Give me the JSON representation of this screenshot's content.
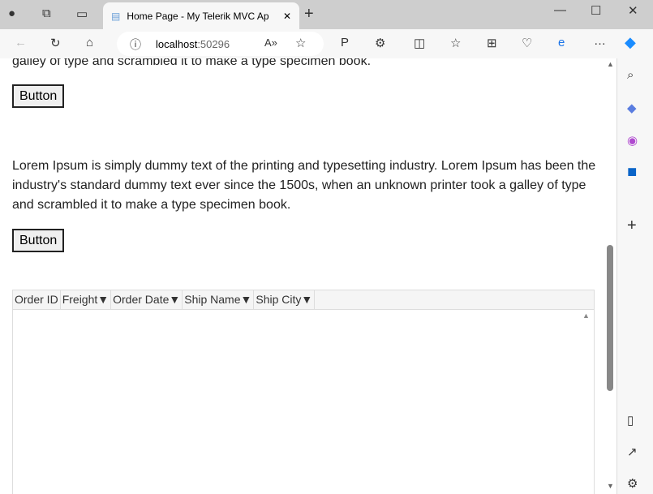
{
  "browser": {
    "tab_title": "Home Page - My Telerik MVC Ap",
    "url_host": "localhost",
    "url_port": ":50296"
  },
  "page": {
    "partial_text": "galley of type and scrambled it to make a type specimen book.",
    "button1": "Button",
    "paragraph": "Lorem Ipsum is simply dummy text of the printing and typesetting industry. Lorem Ipsum has been the industry's standard dummy text ever since the 1500s, when an unknown printer took a galley of type and scrambled it to make a type specimen book.",
    "button2": "Button",
    "grid": {
      "columns": [
        "Order ID",
        "Freight",
        "Order Date",
        "Ship Name",
        "Ship City"
      ],
      "filter_icon": "▼"
    }
  }
}
